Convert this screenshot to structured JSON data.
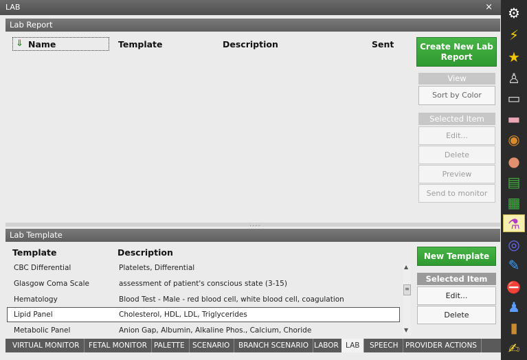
{
  "window": {
    "title": "LAB",
    "close": "×"
  },
  "lab_report": {
    "section_title": "Lab Report",
    "columns": [
      "Name",
      "Template",
      "Description",
      "Sent"
    ],
    "create_button": "Create New Lab Report",
    "view_header": "View",
    "sort_button": "Sort by Color",
    "selected_header": "Selected Item",
    "actions": [
      "Edit...",
      "Delete",
      "Preview",
      "Send to monitor"
    ]
  },
  "lab_template": {
    "section_title": "Lab Template",
    "columns": [
      "Template",
      "Description"
    ],
    "rows": [
      {
        "template": "CBC Differential",
        "description": "Platelets, Differential"
      },
      {
        "template": "Glasgow Coma Scale",
        "description": "assessment of patient's conscious state (3-15)"
      },
      {
        "template": "Hematology",
        "description": "Blood Test - Male - red blood cell, white blood cell, coagulation"
      },
      {
        "template": "Lipid Panel",
        "description": "Cholesterol, HDL, LDL, Triglycerides"
      },
      {
        "template": "Metabolic Panel",
        "description": "Anion Gap, Albumin, Alkaline Phos., Calcium, Choride"
      }
    ],
    "selected_row": "Lipid Panel",
    "new_button": "New Template",
    "selected_header": "Selected Item",
    "actions": [
      "Edit...",
      "Delete"
    ]
  },
  "tabs": [
    "VIRTUAL MONITOR",
    "FETAL MONITOR",
    "PALETTE",
    "SCENARIO",
    "BRANCH SCENARIO",
    "LABOR",
    "LAB",
    "SPEECH",
    "PROVIDER ACTIONS"
  ],
  "active_tab": "LAB",
  "toolbar": [
    {
      "icon": "gear-icon",
      "glyph": "⚙",
      "color": "#ffffff"
    },
    {
      "icon": "lightning-icon",
      "glyph": "⚡",
      "color": "#f5d000"
    },
    {
      "icon": "star-icon",
      "glyph": "★",
      "color": "#f5c400"
    },
    {
      "icon": "person-icon",
      "glyph": "♙",
      "color": "#dddddd"
    },
    {
      "icon": "monitor-icon",
      "glyph": "▭",
      "color": "#dddddd"
    },
    {
      "icon": "pink-monitor-icon",
      "glyph": "▬",
      "color": "#e9a7b6"
    },
    {
      "icon": "palette-icon",
      "glyph": "◉",
      "color": "#d88a2c"
    },
    {
      "icon": "ear-icon",
      "glyph": "●",
      "color": "#e0906c"
    },
    {
      "icon": "vertical-tree-icon",
      "glyph": "▤",
      "color": "#41b041"
    },
    {
      "icon": "network-icon",
      "glyph": "▦",
      "color": "#41b041"
    },
    {
      "icon": "flask-icon",
      "glyph": "⚗",
      "color": "#b03cc8"
    },
    {
      "icon": "headset-icon",
      "glyph": "◎",
      "color": "#6a6aff"
    },
    {
      "icon": "syringe-icon",
      "glyph": "✎",
      "color": "#3aa0ff"
    },
    {
      "icon": "stop-hand-icon",
      "glyph": "⛔",
      "color": "#e02020"
    },
    {
      "icon": "people-icon",
      "glyph": "♟",
      "color": "#5a9cff"
    },
    {
      "icon": "book-icon",
      "glyph": "▮",
      "color": "#c98a30"
    },
    {
      "icon": "note-edit-icon",
      "glyph": "✍",
      "color": "#f0d040"
    }
  ]
}
